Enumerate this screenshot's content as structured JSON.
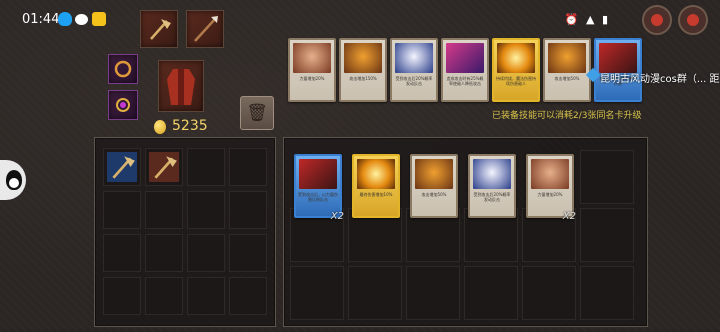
{
  "status": {
    "time": "01:44",
    "right_icons": "⏰ ▲ ▮"
  },
  "gold": {
    "amount": "5235"
  },
  "equipped_hint": "已装备技能可以消耗2/3张同名卡升级",
  "group_label": "昆明古风动漫cos群（... 距",
  "icons": {
    "trash": "🗑"
  },
  "equipped_cards": [
    {
      "art": "fist",
      "style": "normal",
      "desc": "力量增加20%"
    },
    {
      "art": "shield",
      "style": "normal",
      "desc": "攻击增加150%"
    },
    {
      "art": "bolt",
      "style": "normal",
      "desc": "受到攻击后20%概率发动反击"
    },
    {
      "art": "magic",
      "style": "normal",
      "desc": "造成攻击时有25%概率使敌人降低攻击"
    },
    {
      "art": "fire",
      "style": "gold",
      "desc": "持续灼烧，魔法伤害持续伤害敌人"
    },
    {
      "art": "shield",
      "style": "normal",
      "desc": "攻击增加50%"
    },
    {
      "art": "sword",
      "style": "blue",
      "desc": "攻击后50%概率暴击伤害"
    }
  ],
  "inventory_cards": [
    {
      "art": "sword",
      "style": "blue",
      "desc": "受到攻击后，以力量伤害比例反击",
      "count": "X2"
    },
    {
      "art": "fire",
      "style": "gold",
      "desc": "最终伤害增加10%",
      "count": ""
    },
    {
      "art": "shield",
      "style": "normal",
      "desc": "攻击增加50%",
      "count": ""
    },
    {
      "art": "bolt",
      "style": "normal",
      "desc": "受到攻击后20%概率发动反击",
      "count": ""
    },
    {
      "art": "fist",
      "style": "normal",
      "desc": "力量增加20%",
      "count": "X2"
    }
  ]
}
